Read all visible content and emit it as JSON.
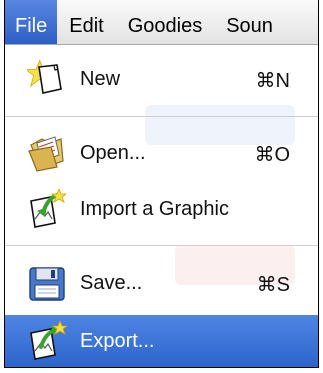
{
  "menubar": {
    "items": [
      {
        "label": "File"
      },
      {
        "label": "Edit"
      },
      {
        "label": "Goodies"
      },
      {
        "label": "Soun"
      }
    ],
    "active_index": 0,
    "active_color": "#3f6fd1"
  },
  "menu": {
    "items": [
      {
        "label": "New",
        "shortcut": "⌘N",
        "icon": "new-document-star-icon"
      },
      {
        "label": "Open...",
        "shortcut": "⌘O",
        "icon": "open-folder-icon"
      },
      {
        "label": "Import a Graphic",
        "shortcut": "",
        "icon": "import-graphic-icon"
      },
      {
        "label": "Save...",
        "shortcut": "⌘S",
        "icon": "floppy-disk-icon"
      },
      {
        "label": "Export...",
        "shortcut": "",
        "icon": "export-graphic-icon"
      }
    ],
    "highlighted_index": 4,
    "highlight_color": "#3874d8"
  }
}
